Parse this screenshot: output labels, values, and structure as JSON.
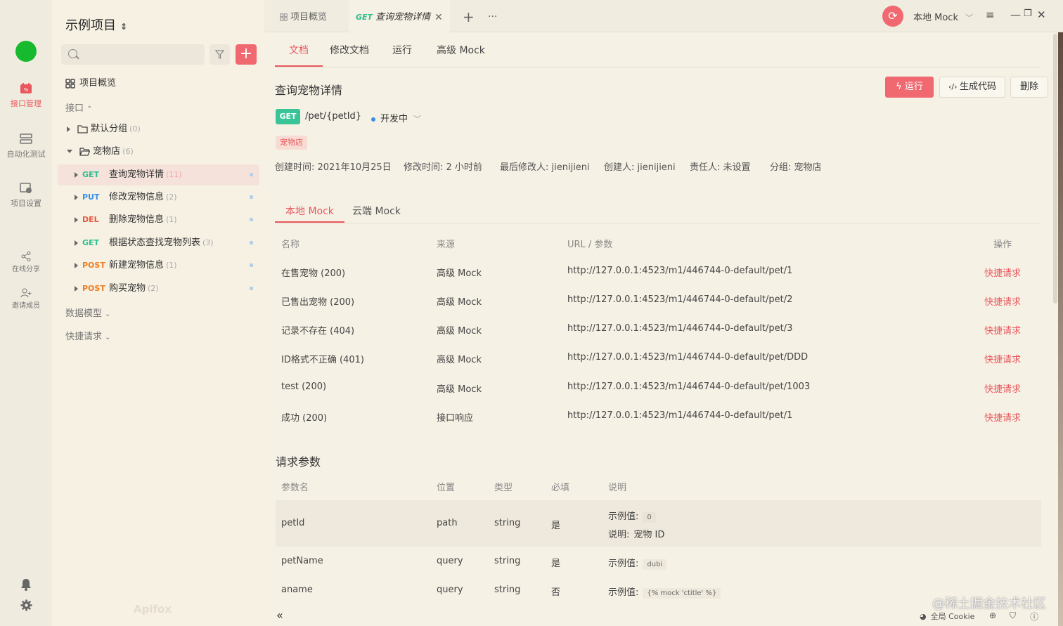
{
  "rail": {
    "items": [
      {
        "label": "接口管理",
        "icon": "api-manage-icon"
      },
      {
        "label": "自动化测试",
        "icon": "automation-icon"
      },
      {
        "label": "项目设置",
        "icon": "project-settings-icon"
      },
      {
        "label": "在线分享",
        "icon": "share-icon"
      },
      {
        "label": "邀请成员",
        "icon": "invite-member-icon"
      }
    ]
  },
  "sidebar": {
    "project_title": "示例项目",
    "search_placeholder": "",
    "overview": "项目概览",
    "interfaces_label": "接口",
    "groups": [
      {
        "name": "默认分组",
        "count": "(0)"
      },
      {
        "name": "宠物店",
        "count": "(6)"
      }
    ],
    "apis": [
      {
        "method": "GET",
        "name": "查询宠物详情",
        "count": "(11)"
      },
      {
        "method": "PUT",
        "name": "修改宠物信息",
        "count": "(2)"
      },
      {
        "method": "DEL",
        "name": "删除宠物信息",
        "count": "(1)"
      },
      {
        "method": "GET",
        "name": "根据状态查找宠物列表",
        "count": "(3)"
      },
      {
        "method": "POST",
        "name": "新建宠物信息",
        "count": "(1)"
      },
      {
        "method": "POST",
        "name": "购买宠物",
        "count": "(2)"
      }
    ],
    "data_models": "数据模型",
    "quick_requests": "快捷请求",
    "brand": "Apifox"
  },
  "tabbar": {
    "overview_tab": "项目概览",
    "active_method": "GET",
    "active_tab": "查询宠物详情",
    "add": "+",
    "more": "···",
    "mock_env": "本地 Mock"
  },
  "subtabs": [
    "文档",
    "修改文档",
    "运行",
    "高级 Mock"
  ],
  "api": {
    "title": "查询宠物详情",
    "run": "运行",
    "gen_code": "生成代码",
    "delete": "删除",
    "method": "GET",
    "path": "/pet/{petId}",
    "status": "开发中",
    "tag": "宠物店",
    "meta": [
      "创建时间: 2021年10月25日",
      "修改时间: 2 小时前",
      "最后修改人: jienijieni",
      "创建人: jienijieni",
      "责任人: 未设置",
      "分组: 宠物店"
    ]
  },
  "mock": {
    "tabs": [
      "本地 Mock",
      "云端 Mock"
    ],
    "headers": [
      "名称",
      "来源",
      "URL / 参数",
      "操作"
    ],
    "rows": [
      {
        "name": "在售宠物 (200)",
        "source": "高级 Mock",
        "url": "http://127.0.0.1:4523/m1/446744-0-default/pet/1",
        "action": "快捷请求"
      },
      {
        "name": "已售出宠物 (200)",
        "source": "高级 Mock",
        "url": "http://127.0.0.1:4523/m1/446744-0-default/pet/2",
        "action": "快捷请求"
      },
      {
        "name": "记录不存在 (404)",
        "source": "高级 Mock",
        "url": "http://127.0.0.1:4523/m1/446744-0-default/pet/3",
        "action": "快捷请求"
      },
      {
        "name": "ID格式不正确 (401)",
        "source": "高级 Mock",
        "url": "http://127.0.0.1:4523/m1/446744-0-default/pet/DDD",
        "action": "快捷请求"
      },
      {
        "name": "test (200)",
        "source": "高级 Mock",
        "url": "http://127.0.0.1:4523/m1/446744-0-default/pet/1003",
        "action": "快捷请求"
      },
      {
        "name": "成功 (200)",
        "source": "接口响应",
        "url": "http://127.0.0.1:4523/m1/446744-0-default/pet/1",
        "action": "快捷请求"
      }
    ]
  },
  "params": {
    "title": "请求参数",
    "headers": [
      "参数名",
      "位置",
      "类型",
      "必填",
      "说明"
    ],
    "example_label": "示例值:",
    "desc_label": "说明:",
    "rows": [
      {
        "name": "petId",
        "in": "path",
        "type": "string",
        "required": "是",
        "example": "0",
        "desc": "宠物 ID"
      },
      {
        "name": "petName",
        "in": "query",
        "type": "string",
        "required": "是",
        "example": "dubi"
      },
      {
        "name": "aname",
        "in": "query",
        "type": "string",
        "required": "否",
        "example": "{% mock 'ctitle' %}"
      }
    ]
  },
  "footer": {
    "collapse": "«",
    "cookie": "全局 Cookie",
    "watermark": "@稀土掘金技术社区"
  },
  "colors": {
    "accent": "#f06870",
    "get": "#2fbd90",
    "put": "#3b8ee8",
    "del": "#e8583c",
    "post": "#ed7d24"
  }
}
